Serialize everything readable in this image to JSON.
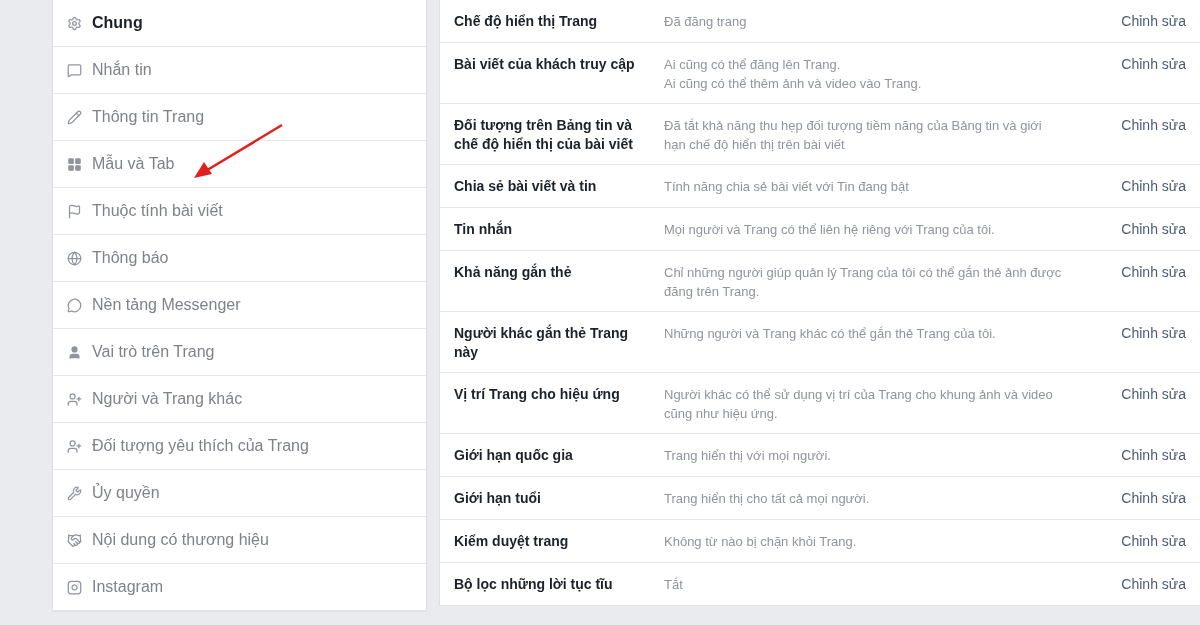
{
  "sidebar": {
    "items": [
      {
        "label": "Chung",
        "selected": true
      },
      {
        "label": "Nhắn tin",
        "selected": false
      },
      {
        "label": "Thông tin Trang",
        "selected": false
      },
      {
        "label": "Mẫu và Tab",
        "selected": false
      },
      {
        "label": "Thuộc tính bài viết",
        "selected": false
      },
      {
        "label": "Thông báo",
        "selected": false
      },
      {
        "label": "Nền tảng Messenger",
        "selected": false
      },
      {
        "label": "Vai trò trên Trang",
        "selected": false
      },
      {
        "label": "Người và Trang khác",
        "selected": false
      },
      {
        "label": "Đối tượng yêu thích của Trang",
        "selected": false
      },
      {
        "label": "Ủy quyền",
        "selected": false
      },
      {
        "label": "Nội dung có thương hiệu",
        "selected": false
      },
      {
        "label": "Instagram",
        "selected": false
      }
    ]
  },
  "settings": {
    "rows": [
      {
        "name": "Chế độ hiển thị Trang",
        "value": [
          "Đã đăng trang"
        ],
        "action": "Chỉnh sửa"
      },
      {
        "name": "Bài viết của khách truy cập",
        "value": [
          "Ai cũng có thể đăng lên Trang.",
          "Ai cũng có thể thêm ảnh và video vào Trang."
        ],
        "action": "Chỉnh sửa"
      },
      {
        "name": "Đối tượng trên Bảng tin và chế độ hiển thị của bài viết",
        "value": [
          "Đã tắt khả năng thu hẹp đối tượng tiềm năng của Bảng tin và giới hạn chế độ hiển thị trên bài viết"
        ],
        "action": "Chỉnh sửa"
      },
      {
        "name": "Chia sẻ bài viết và tin",
        "value": [
          "Tính năng chia sẻ bài viết với Tin đang bật"
        ],
        "action": "Chỉnh sửa"
      },
      {
        "name": "Tin nhắn",
        "value": [
          "Mọi người và Trang có thể liên hệ riêng với Trang của tôi."
        ],
        "action": "Chỉnh sửa"
      },
      {
        "name": "Khả năng gắn thẻ",
        "value": [
          "Chỉ những người giúp quản lý Trang của tôi có thể gắn thẻ ảnh được đăng trên Trang."
        ],
        "action": "Chỉnh sửa"
      },
      {
        "name": "Người khác gắn thẻ Trang này",
        "value": [
          "Những người và Trang khác có thể gắn thẻ Trang của tôi."
        ],
        "action": "Chỉnh sửa"
      },
      {
        "name": "Vị trí Trang cho hiệu ứng",
        "value": [
          "Người khác có thể sử dụng vị trí của Trang cho khung ảnh và video cũng như hiệu ứng."
        ],
        "action": "Chỉnh sửa"
      },
      {
        "name": "Giới hạn quốc gia",
        "value": [
          "Trang hiển thị với mọi người."
        ],
        "action": "Chỉnh sửa"
      },
      {
        "name": "Giới hạn tuổi",
        "value": [
          "Trang hiển thị cho tất cả mọi người."
        ],
        "action": "Chỉnh sửa"
      },
      {
        "name": "Kiểm duyệt trang",
        "value": [
          "Không từ nào bị chặn khỏi Trang."
        ],
        "action": "Chỉnh sửa"
      },
      {
        "name": "Bộ lọc những lời tục tĩu",
        "value": [
          "Tắt"
        ],
        "action": "Chỉnh sửa"
      }
    ]
  }
}
